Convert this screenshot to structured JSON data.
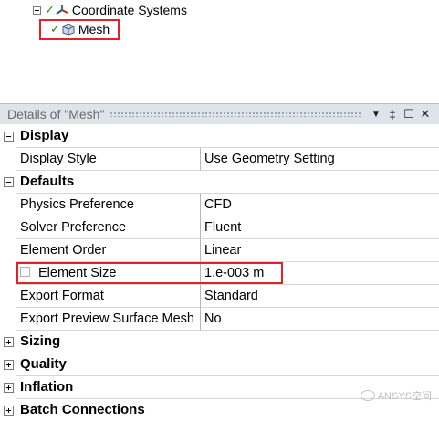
{
  "tree": {
    "items": [
      {
        "label": "Coordinate Systems",
        "icon": "coordinate-axes-icon",
        "status": "check-icon"
      },
      {
        "label": "Mesh",
        "icon": "mesh-icon",
        "status": "check-icon"
      }
    ]
  },
  "details": {
    "title": "Details of \"Mesh\"",
    "buttons": {
      "dropdown": "▼",
      "pin": "‡",
      "maximize": "☐",
      "close": "✕"
    }
  },
  "groups": {
    "display": {
      "label": "Display"
    },
    "defaults": {
      "label": "Defaults"
    },
    "sizing": {
      "label": "Sizing"
    },
    "quality": {
      "label": "Quality"
    },
    "inflation": {
      "label": "Inflation"
    },
    "batch": {
      "label": "Batch Connections"
    }
  },
  "properties": {
    "display_style": {
      "name": "Display Style",
      "value": "Use Geometry Setting"
    },
    "physics_preference": {
      "name": "Physics Preference",
      "value": "CFD"
    },
    "solver_preference": {
      "name": "Solver Preference",
      "value": "Fluent"
    },
    "element_order": {
      "name": "Element Order",
      "value": "Linear"
    },
    "element_size": {
      "name": "Element Size",
      "value": "1.e-003 m"
    },
    "export_format": {
      "name": "Export Format",
      "value": "Standard"
    },
    "export_preview": {
      "name": "Export Preview Surface Mesh",
      "value": "No"
    }
  },
  "watermark": {
    "text": "ANSYS空间"
  },
  "colors": {
    "highlight": "#e0222a",
    "check": "#1a8a1a",
    "header_bg": "#dfe3ea"
  }
}
